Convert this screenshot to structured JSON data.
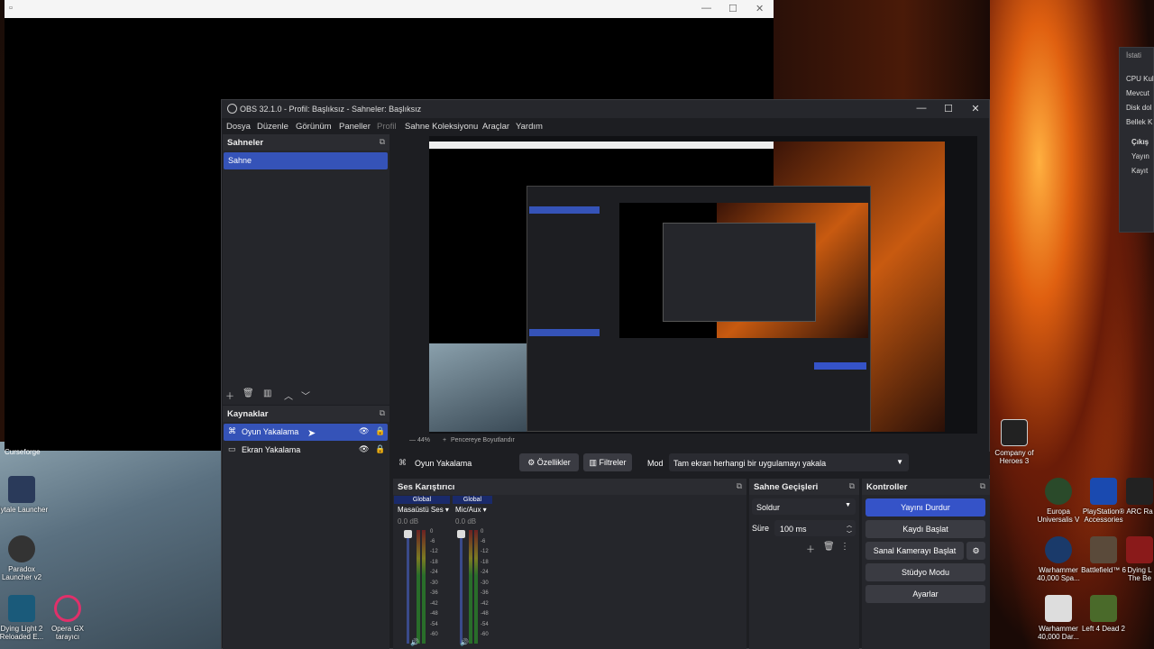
{
  "obs": {
    "title": "OBS 32.1.0 - Profil: Başlıksız - Sahneler: Başlıksız",
    "menu": [
      "Dosya",
      "Düzenle",
      "Görünüm",
      "Paneller",
      "Profil",
      "Sahne Koleksiyonu",
      "Araçlar",
      "Yardım"
    ],
    "scenes": {
      "header": "Sahneler",
      "items": [
        "Sahne"
      ]
    },
    "sources": {
      "header": "Kaynaklar",
      "items": [
        "Oyun Yakalama",
        "Ekran Yakalama"
      ]
    },
    "source_toolbar": {
      "selected": "Oyun Yakalama",
      "properties": "Özellikler",
      "filters": "Filtreler",
      "mode_label": "Mod",
      "mode_value": "Tam ekran herhangi bir uygulamayı yakala"
    },
    "preview": {
      "zoom": "44%",
      "resize": "Pencereye Boyutlandır"
    },
    "audio": {
      "header": "Ses Karıştırıcı",
      "channels": [
        {
          "badge": "Global",
          "name": "Masaüstü Ses",
          "db": "0.0 dB"
        },
        {
          "badge": "Global",
          "name": "Mic/Aux",
          "db": "0.0 dB"
        }
      ],
      "scale": [
        "0",
        "-6",
        "-12",
        "-18",
        "-24",
        "-30",
        "-36",
        "-42",
        "-48",
        "-54",
        "-60"
      ]
    },
    "transitions": {
      "header": "Sahne Geçişleri",
      "type": "Soldur",
      "duration_label": "Süre",
      "duration": "100 ms"
    },
    "controls": {
      "header": "Kontroller",
      "stop_stream": "Yayını Durdur",
      "start_record": "Kaydı Başlat",
      "virtual_cam": "Sanal Kamerayı Başlat",
      "studio_mode": "Stüdyo Modu",
      "settings": "Ayarlar"
    }
  },
  "stats_window": {
    "title": "İstati",
    "rows": [
      "CPU Kul",
      "Mevcut",
      "Disk dol",
      "Bellek K"
    ],
    "section": "Çıkış",
    "sub": [
      "Yayın",
      "Kayıt"
    ]
  },
  "desktop_icons": [
    {
      "label": "Hytale Launcher"
    },
    {
      "label": "Paradox Launcher v2"
    },
    {
      "label": "Dying Light 2 Reloaded E..."
    },
    {
      "label": "Opera GX tarayıcı"
    },
    {
      "label": "Company of Heroes 3"
    },
    {
      "label": "Europa Universalis V"
    },
    {
      "label": "PlayStation® Accessories"
    },
    {
      "label": "ARC Ra"
    },
    {
      "label": "Warhammer 40,000 Spa..."
    },
    {
      "label": "Battlefield™ 6"
    },
    {
      "label": "Dying L The Be"
    },
    {
      "label": "Warhammer 40,000 Dar..."
    },
    {
      "label": "Left 4 Dead 2"
    }
  ],
  "left_partial_label": "Curseforge"
}
